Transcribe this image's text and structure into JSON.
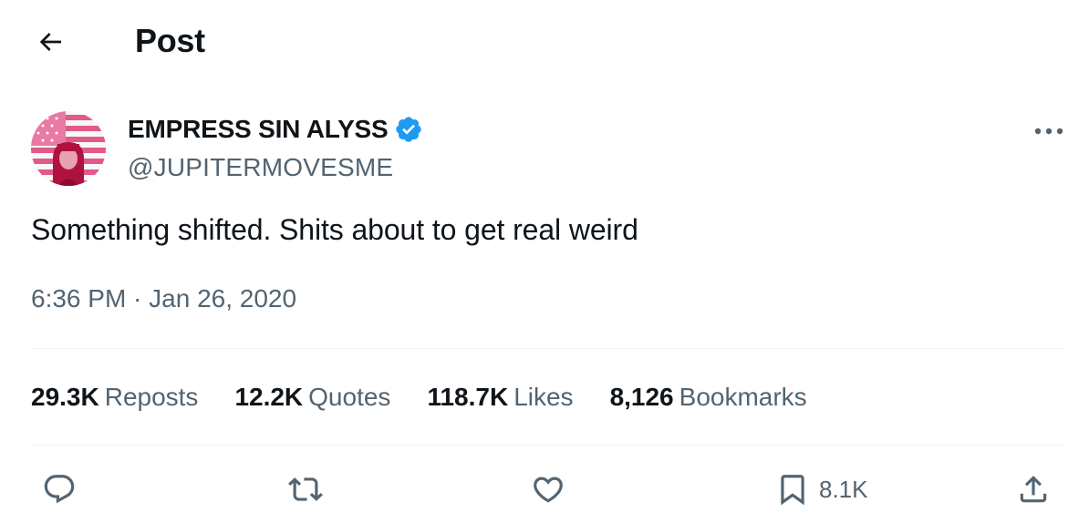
{
  "header": {
    "title": "Post"
  },
  "author": {
    "display_name": "EMPRESS SIN ALYSS",
    "handle": "@JUPITERMOVESME",
    "verified": true,
    "badge_color": "#1d9bf0"
  },
  "tweet": {
    "text": "Something shifted. Shits about to get real weird",
    "timestamp": "6:36 PM · Jan 26, 2020"
  },
  "stats": [
    {
      "value": "29.3K",
      "label": "Reposts"
    },
    {
      "value": "12.2K",
      "label": "Quotes"
    },
    {
      "value": "118.7K",
      "label": "Likes"
    },
    {
      "value": "8,126",
      "label": "Bookmarks"
    }
  ],
  "actions": {
    "reply": {
      "icon": "reply-icon"
    },
    "repost": {
      "icon": "repost-icon"
    },
    "like": {
      "icon": "heart-icon"
    },
    "bookmark": {
      "icon": "bookmark-icon",
      "count": "8.1K"
    },
    "share": {
      "icon": "share-icon"
    }
  },
  "colors": {
    "text": "#0f1419",
    "secondary": "#536471",
    "divider": "#eff3f4"
  }
}
